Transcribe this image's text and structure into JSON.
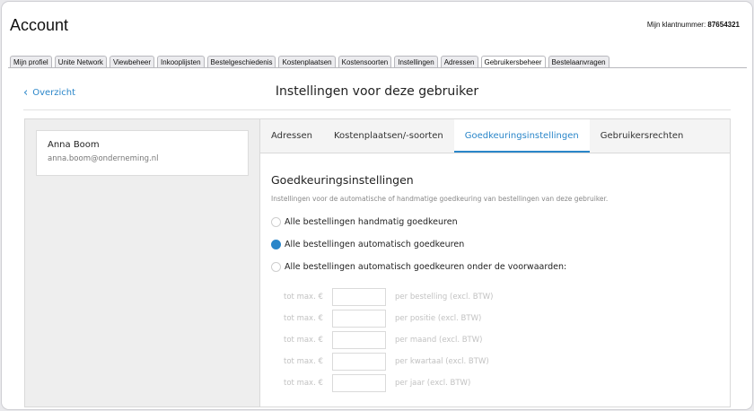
{
  "header": {
    "title": "Account",
    "customer_label": "Mijn klantnummer:",
    "customer_number": "87654321"
  },
  "tabs": [
    {
      "label": "Mijn profiel",
      "active": false
    },
    {
      "label": "Unite Network",
      "active": false
    },
    {
      "label": "Viewbeheer",
      "active": false
    },
    {
      "label": "Inkooplijsten",
      "active": false
    },
    {
      "label": "Bestelgeschiedenis",
      "active": false
    },
    {
      "label": "Kostenplaatsen",
      "active": false
    },
    {
      "label": "Kostensoorten",
      "active": false
    },
    {
      "label": "Instellingen",
      "active": false
    },
    {
      "label": "Adressen",
      "active": false
    },
    {
      "label": "Gebruikersbeheer",
      "active": true
    },
    {
      "label": "Bestelaanvragen",
      "active": false
    }
  ],
  "page": {
    "back_label": "Overzicht",
    "title": "Instellingen voor deze gebruiker"
  },
  "user": {
    "name": "Anna Boom",
    "email": "anna.boom@onderneming.nl"
  },
  "subtabs": [
    {
      "label": "Adressen",
      "active": false
    },
    {
      "label": "Kostenplaatsen/-soorten",
      "active": false
    },
    {
      "label": "Goedkeuringsinstellingen",
      "active": true
    },
    {
      "label": "Gebruikersrechten",
      "active": false
    }
  ],
  "approval": {
    "title": "Goedkeuringsinstellingen",
    "description": "Instellingen voor de automatische of handmatige goedkeuring van bestellingen van deze gebruiker.",
    "options": [
      {
        "label": "Alle bestellingen handmatig goedkeuren",
        "selected": false
      },
      {
        "label": "Alle bestellingen automatisch goedkeuren",
        "selected": true
      },
      {
        "label": "Alle bestellingen automatisch goedkeuren onder de voorwaarden:",
        "selected": false
      }
    ],
    "limit_prefix": "tot max. €",
    "limits": [
      {
        "value": "",
        "suffix": "per bestelling (excl. BTW)"
      },
      {
        "value": "",
        "suffix": "per positie (excl. BTW)"
      },
      {
        "value": "",
        "suffix": "per maand (excl. BTW)"
      },
      {
        "value": "",
        "suffix": "per kwartaal (excl. BTW)"
      },
      {
        "value": "",
        "suffix": "per jaar (excl. BTW)"
      }
    ]
  },
  "colors": {
    "accent": "#2a86c9"
  }
}
